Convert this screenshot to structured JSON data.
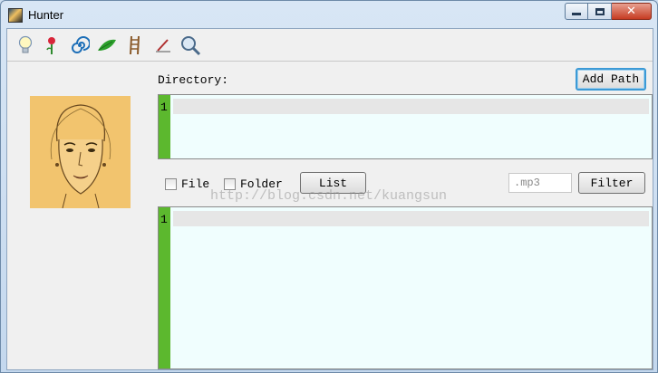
{
  "window": {
    "title": "Hunter"
  },
  "toolbar": {
    "icons": [
      "lightbulb-icon",
      "flower-icon",
      "spiral-icon",
      "leaf-icon",
      "ladder-icon",
      "pen-icon",
      "magnifier-icon"
    ]
  },
  "directory": {
    "label": "Directory:",
    "add_path_label": "Add Path",
    "line_number": "1"
  },
  "filters": {
    "file_label": "File",
    "folder_label": "Folder",
    "list_label": "List",
    "extension_value": ".mp3",
    "filter_label": "Filter"
  },
  "results": {
    "line_number": "1"
  },
  "watermark": "http://blog.csdn.net/kuangsun"
}
